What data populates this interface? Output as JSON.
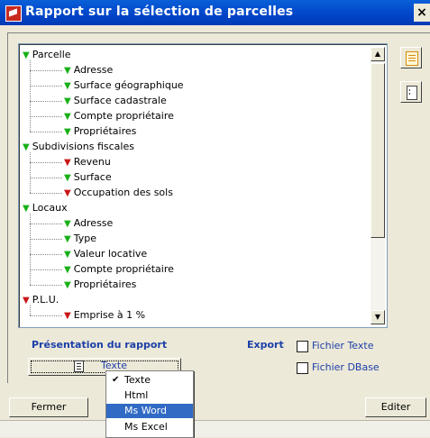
{
  "window": {
    "title": "Rapport sur la sélection de parcelles",
    "close_label": "×"
  },
  "tree": {
    "rows": [
      {
        "label": "Parcelle",
        "marker": "green",
        "level": 0
      },
      {
        "label": "Adresse",
        "marker": "green",
        "level": 1
      },
      {
        "label": "Surface géographique",
        "marker": "green",
        "level": 1
      },
      {
        "label": "Surface cadastrale",
        "marker": "green",
        "level": 1
      },
      {
        "label": "Compte propriétaire",
        "marker": "green",
        "level": 1
      },
      {
        "label": "Propriétaires",
        "marker": "green",
        "level": 1
      },
      {
        "label": "Subdivisions fiscales",
        "marker": "green",
        "level": 0
      },
      {
        "label": "Revenu",
        "marker": "red",
        "level": 1
      },
      {
        "label": "Surface",
        "marker": "green",
        "level": 1
      },
      {
        "label": "Occupation des sols",
        "marker": "red",
        "level": 1
      },
      {
        "label": "Locaux",
        "marker": "green",
        "level": 0
      },
      {
        "label": "Adresse",
        "marker": "green",
        "level": 1
      },
      {
        "label": "Type",
        "marker": "green",
        "level": 1
      },
      {
        "label": "Valeur locative",
        "marker": "green",
        "level": 1
      },
      {
        "label": "Compte propriétaire",
        "marker": "green",
        "level": 1
      },
      {
        "label": "Propriétaires",
        "marker": "green",
        "level": 1
      },
      {
        "label": "P.L.U.",
        "marker": "red",
        "level": 0
      },
      {
        "label": "Emprise à 1 %",
        "marker": "red",
        "level": 1
      }
    ],
    "marker_glyph": "▼"
  },
  "scrollbar": {
    "up_glyph": "▲",
    "down_glyph": "▼"
  },
  "side_buttons": {
    "expand_icon": "list-expand-icon",
    "collapse_icon": "list-collapse-icon"
  },
  "presentation": {
    "label": "Présentation du rapport",
    "selected_value": "Texte"
  },
  "export": {
    "label": "Export",
    "options": [
      {
        "label": "Fichier Texte",
        "checked": false
      },
      {
        "label": "Fichier DBase",
        "checked": false
      }
    ]
  },
  "dropdown_menu": {
    "items": [
      {
        "label": "Texte",
        "checked": true,
        "highlighted": false
      },
      {
        "label": "Html",
        "checked": false,
        "highlighted": false
      },
      {
        "label": "Ms Word",
        "checked": false,
        "highlighted": true
      },
      {
        "label": "Ms Excel",
        "checked": false,
        "highlighted": false
      }
    ],
    "check_glyph": "✔"
  },
  "buttons": {
    "close_label": "Fermer",
    "edit_label": "Editer"
  },
  "colors": {
    "title_bar": "#0054e3",
    "label_blue": "#1c3fa8",
    "marker_green": "#18b018",
    "marker_red": "#c81818",
    "menu_highlight": "#316ac5"
  }
}
